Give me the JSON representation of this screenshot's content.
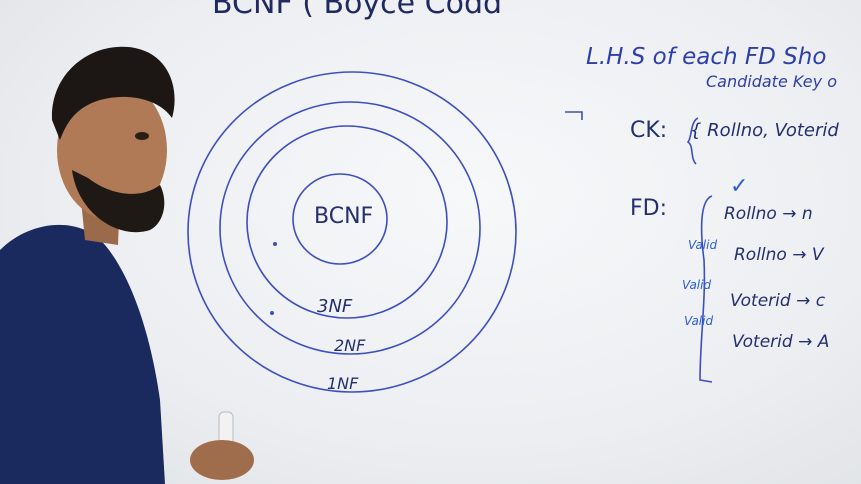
{
  "board": {
    "title": "BCNF ( Boyce Codd",
    "rule_line1": "L.H.S of each FD Sho",
    "rule_line2": "Candidate Key o",
    "ck_label": "CK:",
    "ck_value": "{ Rollno, Voterid",
    "fd_label": "FD:",
    "fd_rows": [
      {
        "left": "Rollno",
        "arrow": "→",
        "right": "n"
      },
      {
        "left": "Rollno",
        "arrow": "→",
        "right": "V"
      },
      {
        "left": "Voterid",
        "arrow": "→",
        "right": "c"
      },
      {
        "left": "Voterid",
        "arrow": "→",
        "right": "A"
      }
    ],
    "valid_marks": [
      "Valid",
      "Valid",
      "Valid"
    ],
    "circles": [
      "BCNF",
      "3NF",
      "2NF",
      "1NF"
    ]
  },
  "colors": {
    "ink": "#2f3fa8",
    "shirt": "#1b2a5e",
    "skin": "#b07a56",
    "hair": "#1c1714"
  }
}
